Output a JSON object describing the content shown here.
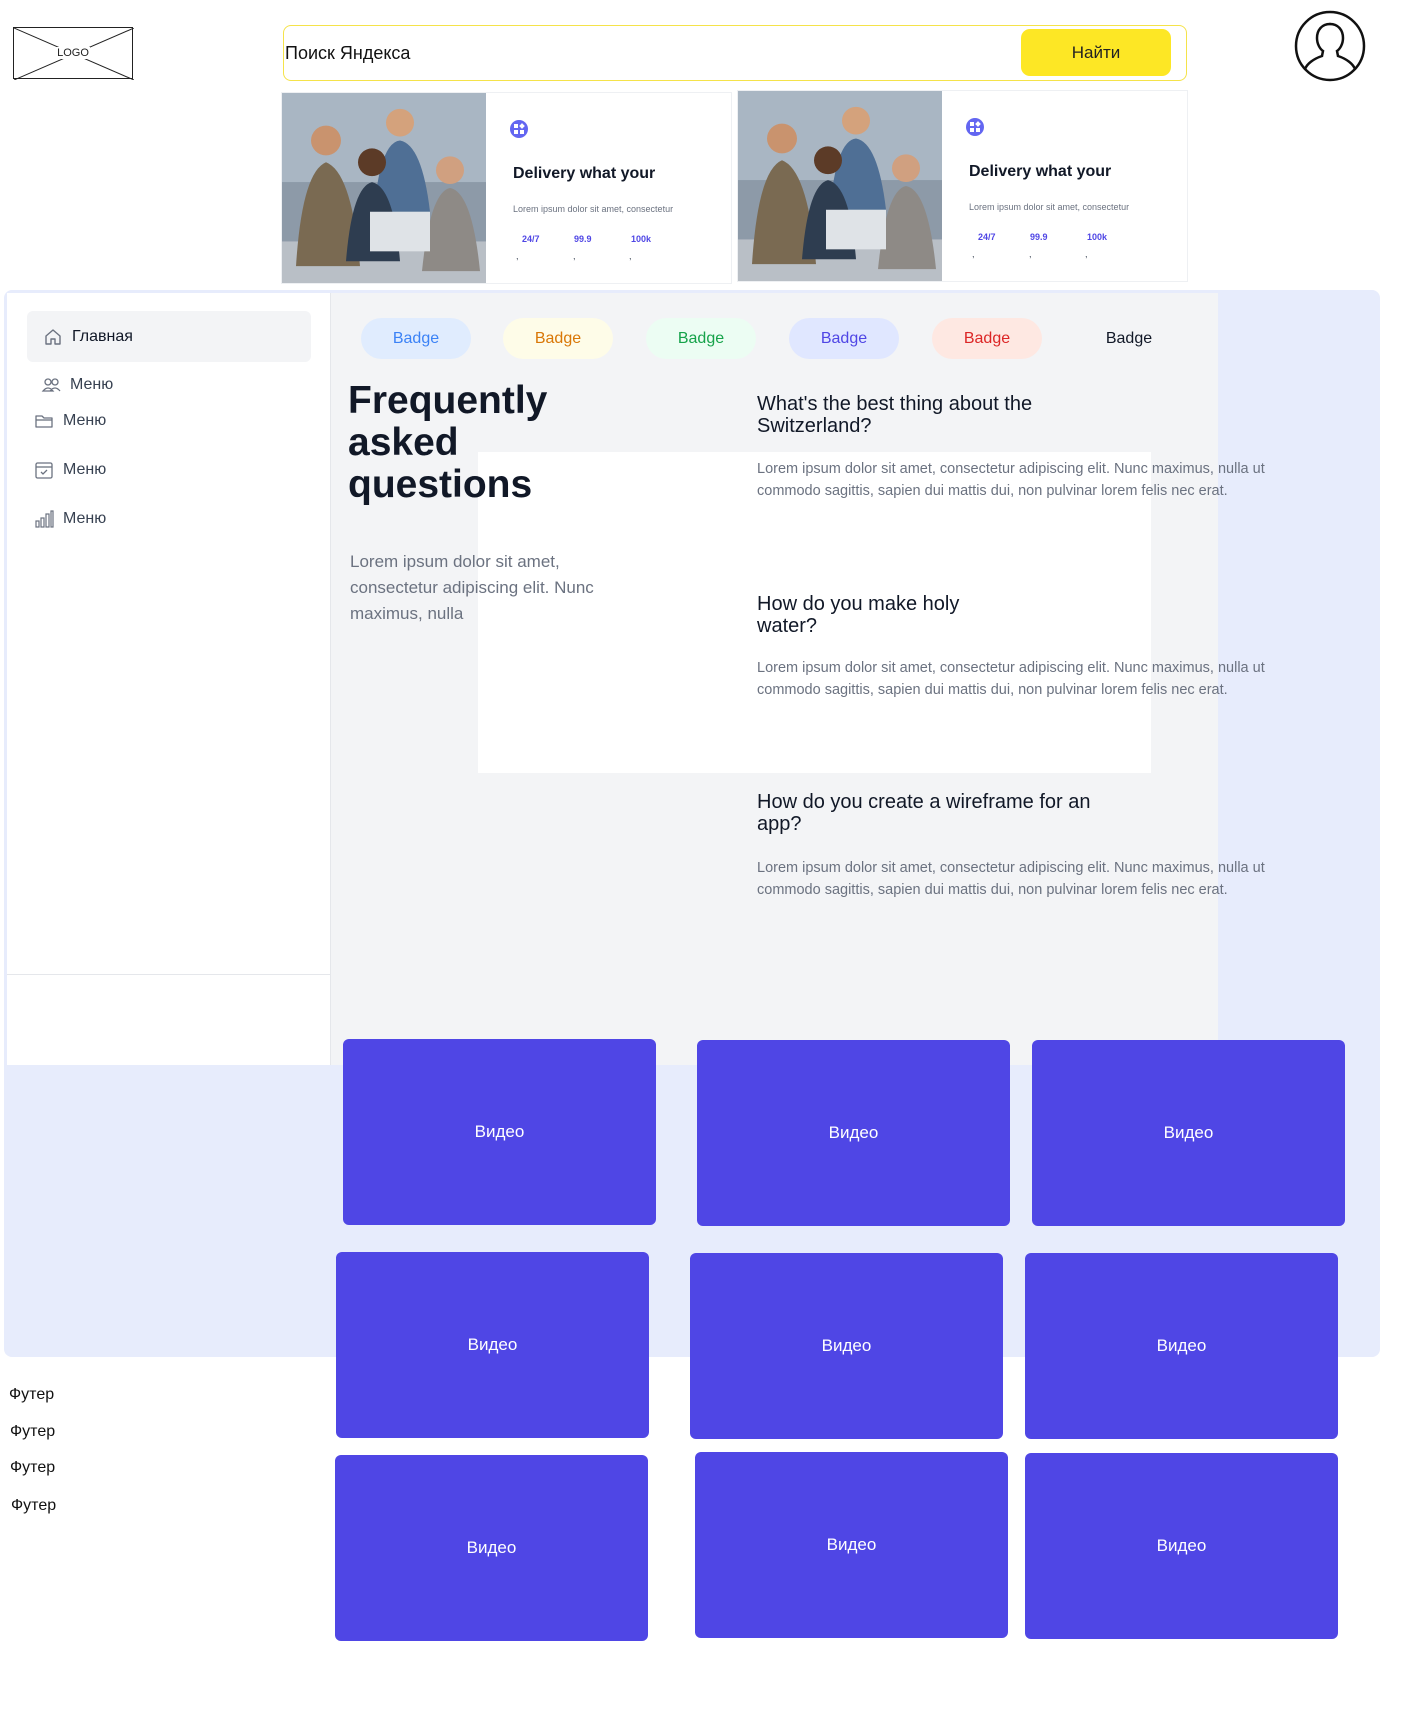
{
  "header": {
    "logo_text": "LOGO",
    "search_placeholder": "Поиск Яндекса",
    "search_button": "Найти"
  },
  "promo_cards": [
    {
      "title": "Delivery what your",
      "description": "Lorem ipsum dolor sit amet, consectetur",
      "stats": [
        "24/7",
        "99.9",
        "100k"
      ]
    },
    {
      "title": "Delivery what your",
      "description": "Lorem ipsum dolor sit amet, consectetur",
      "stats": [
        "24/7",
        "99.9",
        "100k"
      ]
    }
  ],
  "sidebar": {
    "items": [
      {
        "label": "Главная",
        "icon": "home-icon"
      },
      {
        "label": "Меню",
        "icon": "users-icon"
      },
      {
        "label": "Меню",
        "icon": "folder-icon"
      },
      {
        "label": "Меню",
        "icon": "calendar-icon"
      },
      {
        "label": "Меню",
        "icon": "chart-icon"
      }
    ]
  },
  "badges": [
    {
      "label": "Badge",
      "bg": "#e0ecfe",
      "fg": "#3b82f6"
    },
    {
      "label": "Badge",
      "bg": "#fefce8",
      "fg": "#d97706"
    },
    {
      "label": "Badge",
      "bg": "#ecfdf3",
      "fg": "#16a34a"
    },
    {
      "label": "Badge",
      "bg": "#e0e7ff",
      "fg": "#4f46e5"
    },
    {
      "label": "Badge",
      "bg": "#fee8e2",
      "fg": "#dc2626"
    },
    {
      "label": "Badge",
      "bg": "#f3f4f6",
      "fg": "#111827"
    }
  ],
  "faq": {
    "title": "Frequently asked questions",
    "intro": "Lorem ipsum dolor sit amet, consectetur adipiscing elit. Nunc maximus, nulla",
    "items": [
      {
        "question": "What's the best thing about the Switzerland?",
        "answer": "Lorem ipsum dolor sit amet, consectetur adipiscing elit. Nunc maximus, nulla ut commodo sagittis, sapien dui mattis dui, non pulvinar lorem felis nec erat."
      },
      {
        "question": "How do you make holy water?",
        "answer": "Lorem ipsum dolor sit amet, consectetur adipiscing elit. Nunc maximus, nulla ut commodo sagittis, sapien dui mattis dui, non pulvinar lorem felis nec erat."
      },
      {
        "question": "How do you create a wireframe for an app?",
        "answer": "Lorem ipsum dolor sit amet, consectetur adipiscing elit. Nunc maximus, nulla ut commodo sagittis, sapien dui mattis dui, non pulvinar lorem felis nec erat."
      }
    ]
  },
  "videos": [
    "Видео",
    "Видео",
    "Видео",
    "Видео",
    "Видео",
    "Видео",
    "Видео",
    "Видео",
    "Видео"
  ],
  "footer": [
    "Футер",
    "Футер",
    "Футер",
    "Футер"
  ],
  "colors": {
    "accent": "#4f46e5",
    "search_button": "#fde725",
    "main_background": "#e7ecfc",
    "faq_background": "#f3f4f6"
  }
}
